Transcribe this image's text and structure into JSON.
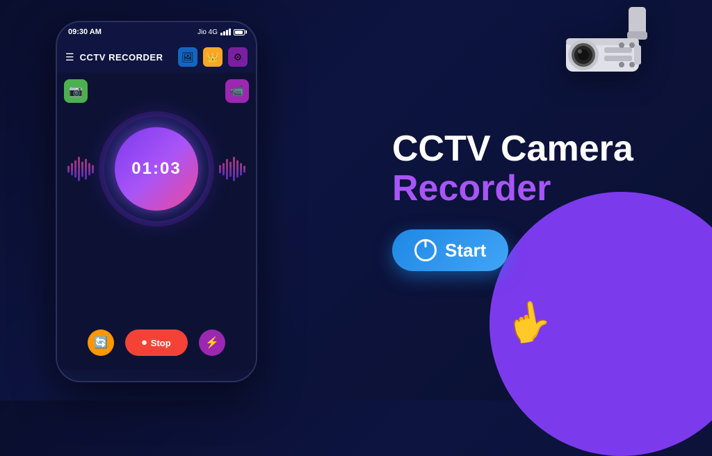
{
  "app": {
    "status_time": "09:30 AM",
    "carrier": "Jio 4G",
    "title": "CCTV RECORDER",
    "timer": "01:03",
    "stop_label": "Stop",
    "start_label": "Start"
  },
  "right": {
    "title_line1": "CCTV Camera",
    "title_line2": "Recorder"
  },
  "icons": {
    "hamburger": "☰",
    "gallery": "🖼",
    "crown": "👑",
    "settings": "⚙",
    "camera_green": "📷",
    "camera_purple": "📹",
    "rotate": "🔄",
    "stop_dot": "⏺",
    "lightning": "⚡",
    "power": "⏻"
  }
}
